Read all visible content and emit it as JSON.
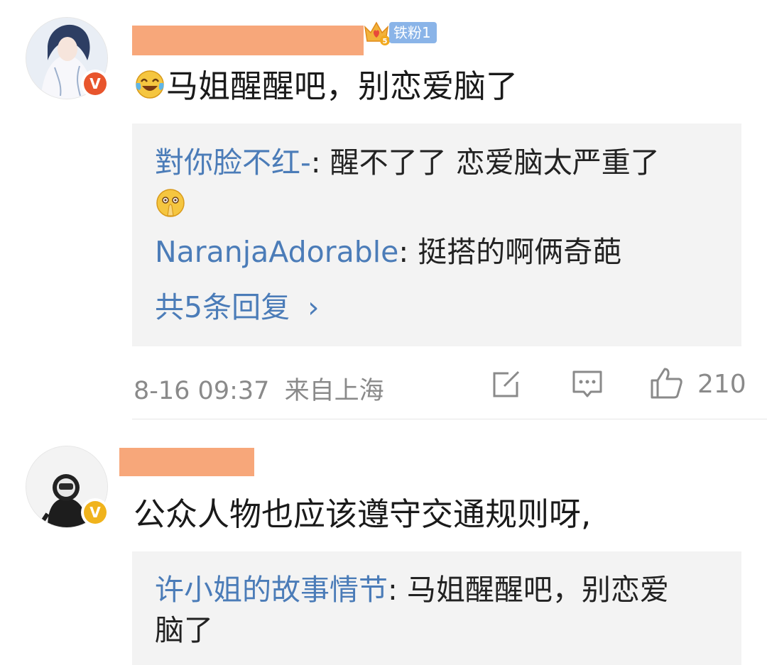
{
  "comments": [
    {
      "fan_badge": {
        "label": "铁粉1",
        "level": "5"
      },
      "badge_color": "#e8552d",
      "text": "马姐醒醒吧，别恋爱脑了",
      "replies": [
        {
          "user": "對你脸不红-",
          "sep": ": ",
          "text_line1": "醒不了了  恋爱脑太严重了"
        },
        {
          "user": "NaranjaAdorable",
          "sep": ": ",
          "text": "挺搭的啊俩奇葩"
        }
      ],
      "more_replies": "共5条回复",
      "more_chevron": "›",
      "time": "8-16 09:37",
      "location": "来自上海",
      "like_count": "210"
    },
    {
      "badge_color": "#f0b31c",
      "text": "公众人物也应该遵守交通规则呀,",
      "replies": [
        {
          "user": "许小姐的故事情节",
          "sep": ": ",
          "text_line1": "马姐醒醒吧，别恋爱",
          "text_line2": "脑了"
        }
      ]
    }
  ],
  "icons": {
    "emoji_laugh_cry": "laughing-crying-emoji",
    "emoji_pray": "praying-emoji",
    "share": "share-edit-icon",
    "comment": "comment-icon",
    "like": "thumbs-up-icon",
    "verified": "verified-v-icon",
    "crown": "crown-icon"
  },
  "colors": {
    "username_blue": "#4b7cb8",
    "reply_bg": "#f3f3f3",
    "meta_gray": "#8a8a8a",
    "redaction": "#f7a77a"
  }
}
